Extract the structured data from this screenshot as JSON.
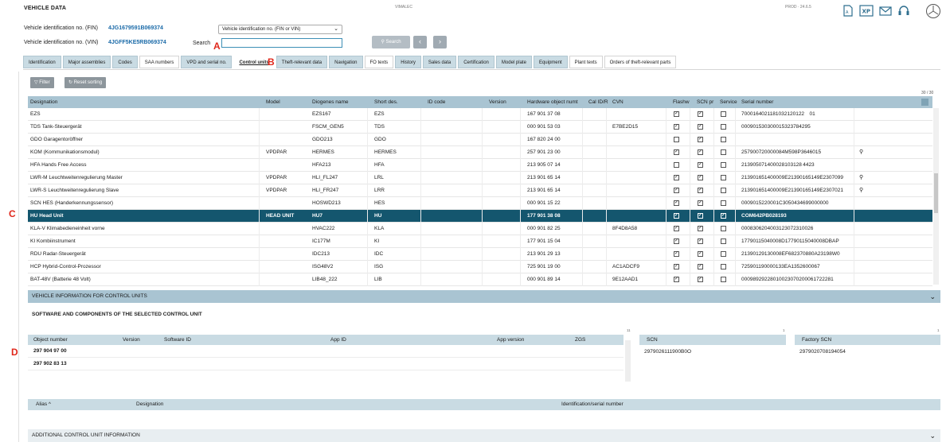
{
  "header": {
    "title": "Vehicle data",
    "center_label": "VIMALEC",
    "prod_label": "PROD · 24.6.5",
    "icons": [
      "pdf-icon",
      "xp-icon",
      "mail-icon",
      "headset-icon",
      "mercedes-logo"
    ]
  },
  "vehicle": {
    "fin_label": "Vehicle identification no. (FIN)",
    "fin_value": "4JG1679591B069374",
    "vin_label": "Vehicle identification no. (VIN)",
    "vin_value": "4JGFF5KE5RB069374",
    "id_select_value": "Vehicle identification no. (FIN or VIN)",
    "search_label": "Search",
    "search_value": "",
    "search_button": "Search"
  },
  "markers": {
    "a": "A",
    "b": "B",
    "c": "C",
    "d": "D"
  },
  "tabs": [
    {
      "label": "Identification",
      "style": "blue"
    },
    {
      "label": "Major assemblies",
      "style": "blue"
    },
    {
      "label": "Codes",
      "style": "blue"
    },
    {
      "label": "SAA numbers",
      "style": "white"
    },
    {
      "label": "VPD and serial no.",
      "style": "blue"
    },
    {
      "label": "Control units",
      "style": "active"
    },
    {
      "label": "Theft-relevant data",
      "style": "blue"
    },
    {
      "label": "Navigation",
      "style": "blue"
    },
    {
      "label": "FO texts",
      "style": "white"
    },
    {
      "label": "History",
      "style": "blue"
    },
    {
      "label": "Sales data",
      "style": "blue"
    },
    {
      "label": "Certification",
      "style": "blue"
    },
    {
      "label": "Model plate",
      "style": "blue"
    },
    {
      "label": "Equipment",
      "style": "blue"
    },
    {
      "label": "Plant texts",
      "style": "white"
    },
    {
      "label": "Orders of theft-relevant parts",
      "style": "white"
    }
  ],
  "toolbar": {
    "filter_label": "Filter",
    "reset_label": "Reset sorting",
    "count": "30 / 30"
  },
  "table": {
    "columns": [
      "Designation",
      "Model",
      "Diogenes name",
      "Short des.",
      "ID code",
      "Version",
      "Hardware object numt",
      "Cal ID/R",
      "CVN",
      "Flashw",
      "SCN pr",
      "Service",
      "Serial number"
    ],
    "rows": [
      {
        "designation": "EZS",
        "model": "",
        "diogenes": "EZS167",
        "short": "EZS",
        "hw": "167 901 37 08",
        "cvn": "",
        "flash": "✓",
        "scn": "✓",
        "service": "",
        "serial": "7000164021181032120122 01",
        "mag": false
      },
      {
        "designation": "TDS Tank-Steuergerät",
        "model": "",
        "diogenes": "FSCM_GEN5",
        "short": "TDS",
        "hw": "000 901 53 03",
        "cvn": "E7BE2D15",
        "flash": "✓",
        "scn": "✓",
        "service": "",
        "serial": "000901530300015323784295",
        "mag": false
      },
      {
        "designation": "GDO Garagentoröffner",
        "model": "",
        "diogenes": "GDO213",
        "short": "GDO",
        "hw": "167 820 24 00",
        "cvn": "",
        "flash": "",
        "scn": "✓",
        "service": "",
        "serial": "",
        "mag": false
      },
      {
        "designation": "KOM (Kommunikationsmodul)",
        "model": "VPDPAR",
        "diogenes": "HERMES",
        "short": "HERMES",
        "hw": "257 901 23 00",
        "cvn": "",
        "flash": "✓",
        "scn": "✓",
        "service": "",
        "serial": "257900720000084M598P3646015",
        "mag": true
      },
      {
        "designation": "HFA Hands Free Access",
        "model": "",
        "diogenes": "HFA213",
        "short": "HFA",
        "hw": "213 905 07 14",
        "cvn": "",
        "flash": "",
        "scn": "✓",
        "service": "",
        "serial": "213905071400028103128 4423",
        "mag": false
      },
      {
        "designation": "LWR-M Leuchtweitenregulierung Master",
        "model": "VPDPAR",
        "diogenes": "HLI_FL247",
        "short": "LRL",
        "hw": "213 901 65 14",
        "cvn": "",
        "flash": "✓",
        "scn": "✓",
        "service": "",
        "serial": "213901651400009E21390165149E2307099",
        "mag": true
      },
      {
        "designation": "LWR-S Leuchtweitenregulierung Slave",
        "model": "VPDPAR",
        "diogenes": "HLI_FR247",
        "short": "LRR",
        "hw": "213 901 65 14",
        "cvn": "",
        "flash": "✓",
        "scn": "✓",
        "service": "",
        "serial": "213901651400009E21390165149E2307021",
        "mag": true
      },
      {
        "designation": "SCN HES (Handerkennungssensor)",
        "model": "",
        "diogenes": "HOSWD213",
        "short": "HES",
        "hw": "000 901 15 22",
        "cvn": "",
        "flash": "✓",
        "scn": "✓",
        "service": "",
        "serial": "0009015220001C3050434699000000",
        "mag": false
      },
      {
        "designation": "HU Head Unit",
        "model": "HEAD UNIT",
        "diogenes": "HU7",
        "short": "HU",
        "hw": "177 901 38 08",
        "cvn": "",
        "flash": "✓",
        "scn": "✓",
        "service": "✓",
        "serial": "COM642PB028193",
        "mag": false,
        "selected": true
      },
      {
        "designation": "KLA-V Klimabedieneinheit vorne",
        "model": "",
        "diogenes": "HVAC222",
        "short": "KLA",
        "hw": "000 901 82 25",
        "cvn": "8F4D8A58",
        "flash": "✓",
        "scn": "✓",
        "service": "",
        "serial": "0008306204003123072310026",
        "mag": false
      },
      {
        "designation": "KI Kombiinstrument",
        "model": "",
        "diogenes": "IC177M",
        "short": "KI",
        "hw": "177 901 15 04",
        "cvn": "",
        "flash": "✓",
        "scn": "✓",
        "service": "",
        "serial": "17790115040008D17790115040008DBAP",
        "mag": false
      },
      {
        "designation": "RDU Radar-Steuergerät",
        "model": "",
        "diogenes": "IDC213",
        "short": "IDC",
        "hw": "213 901 29 13",
        "cvn": "",
        "flash": "✓",
        "scn": "✓",
        "service": "",
        "serial": "21390129130008EF682370880A23198W0",
        "mag": false
      },
      {
        "designation": "HCP Hybrid-Control-Prozessor",
        "model": "",
        "diogenes": "ISG48V2",
        "short": "ISG",
        "hw": "725 901 19 00",
        "cvn": "AC1ADCF9",
        "flash": "✓",
        "scn": "✓",
        "service": "",
        "serial": "725901190000133EA1352600067",
        "mag": false
      },
      {
        "designation": "BAT-48V (Batterie 48 Volt)",
        "model": "",
        "diogenes": "LIB48_222",
        "short": "LIB",
        "hw": "000 901 89 14",
        "cvn": "9E12AAD1",
        "flash": "✓",
        "scn": "✓",
        "service": "",
        "serial": "00098929228010023070200061722281",
        "mag": false
      }
    ]
  },
  "sections": {
    "vehicle_info": "VEHICLE INFORMATION FOR CONTROL UNITS",
    "sw_title": "SOFTWARE AND COMPONENTS OF THE SELECTED CONTROL UNIT",
    "additional": "ADDITIONAL CONTROL UNIT INFORMATION"
  },
  "sw_table": {
    "columns": [
      "Object number",
      "Version",
      "Software ID",
      "App ID",
      "App version",
      "ZGS"
    ],
    "count": "11",
    "rows": [
      {
        "object": "297 904 97 00"
      },
      {
        "object": "297 902 83 13"
      }
    ]
  },
  "scn": {
    "label": "SCN",
    "count": "1",
    "value": "2979026111900B0O"
  },
  "factory_scn": {
    "label": "Factory SCN",
    "count": "1",
    "value": "2979020708194054"
  },
  "alias_table": {
    "columns": [
      "Alias",
      "Designation",
      "Identification/serial number"
    ]
  }
}
